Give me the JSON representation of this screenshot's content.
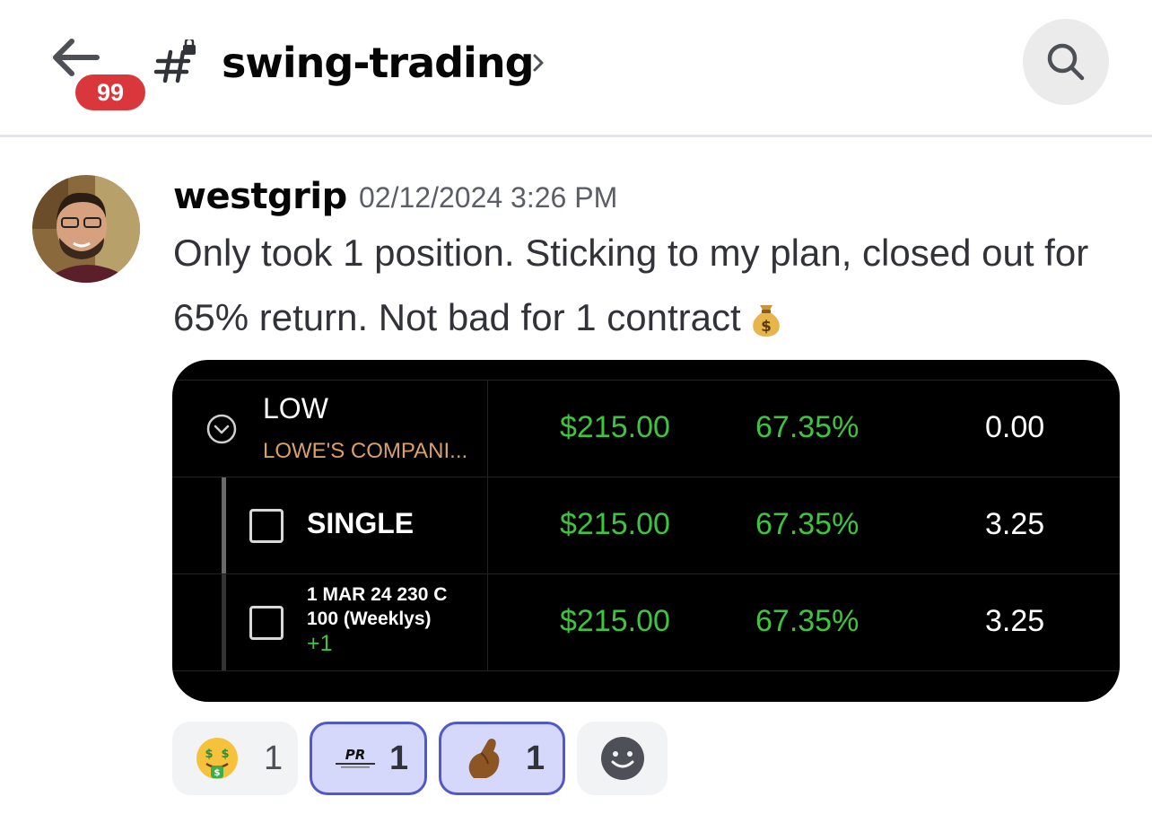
{
  "header": {
    "unread_count": "99",
    "channel_name": "swing-trading",
    "chevron": "›"
  },
  "message": {
    "author": "westgrip",
    "timestamp": "02/12/2024 3:26 PM",
    "text": "Only took 1 position. Sticking to my plan, closed out for 65% return. Not bad for 1 contract",
    "emoji": "money-bag-icon"
  },
  "embed": {
    "rows": [
      {
        "symbol": "LOW",
        "company": "LOWE'S COMPANI...",
        "value": "$215.00",
        "pct": "67.35%",
        "num": "0.00"
      },
      {
        "label": "SINGLE",
        "value": "$215.00",
        "pct": "67.35%",
        "num": "3.25"
      },
      {
        "line1": "1 MAR 24 230 C",
        "line2": "100 (Weeklys)",
        "qty": "+1",
        "value": "$215.00",
        "pct": "67.35%",
        "num": "3.25"
      }
    ],
    "colors": {
      "green": "#3ec43e",
      "company": "#d9a06a"
    }
  },
  "reactions": [
    {
      "emoji": "money-mouth-face-icon",
      "count": "1",
      "active": false
    },
    {
      "emoji": "pr-custom-emoji-icon",
      "count": "1",
      "active": true
    },
    {
      "emoji": "pinched-fingers-icon",
      "count": "1",
      "active": true
    },
    {
      "emoji": "add-reaction-icon"
    }
  ],
  "pr_emoji_text": "PR"
}
